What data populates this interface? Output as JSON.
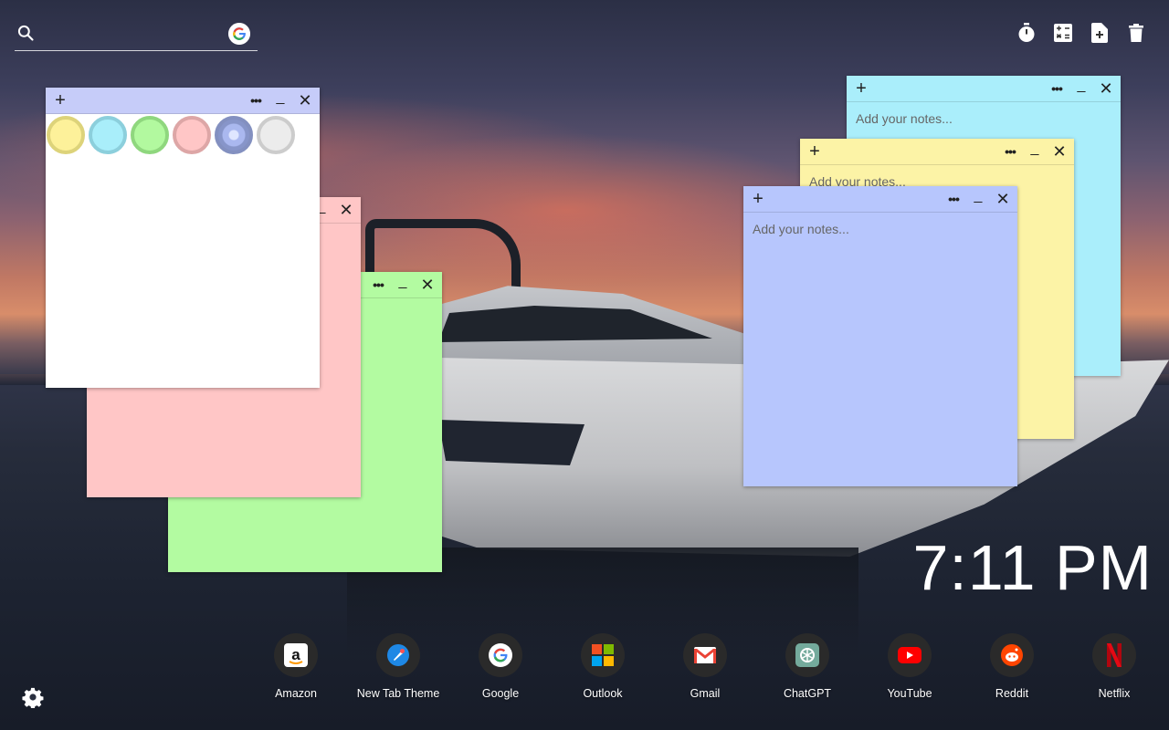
{
  "search": {
    "placeholder": "",
    "value": ""
  },
  "topbar": {
    "icons": [
      "timer-icon",
      "calculator-icon",
      "new-note-icon",
      "trash-icon"
    ]
  },
  "notes": {
    "toolbar": {
      "add": "+",
      "more": "•••",
      "minimize": "_",
      "close": "✕"
    },
    "placeholder": "Add your notes...",
    "swatches": [
      {
        "name": "yellow",
        "fill": "#fdf19a",
        "ring": "#ddd37a"
      },
      {
        "name": "cyan",
        "fill": "#a9eefa",
        "ring": "#8ccfdc"
      },
      {
        "name": "green",
        "fill": "#b2f99f",
        "ring": "#8fd77e"
      },
      {
        "name": "pink",
        "fill": "#ffc6c6",
        "ring": "#dda6a6"
      },
      {
        "name": "blue",
        "fill": "#b6c5fc",
        "ring": "#8390c0"
      },
      {
        "name": "white",
        "fill": "#ececec",
        "ring": "#cccccc"
      }
    ]
  },
  "clock": {
    "time": "7:11 PM"
  },
  "dock": {
    "apps": [
      {
        "label": "Amazon"
      },
      {
        "label": "New Tab Theme"
      },
      {
        "label": "Google"
      },
      {
        "label": "Outlook"
      },
      {
        "label": "Gmail"
      },
      {
        "label": "ChatGPT"
      },
      {
        "label": "YouTube"
      },
      {
        "label": "Reddit"
      },
      {
        "label": "Netflix"
      }
    ]
  }
}
